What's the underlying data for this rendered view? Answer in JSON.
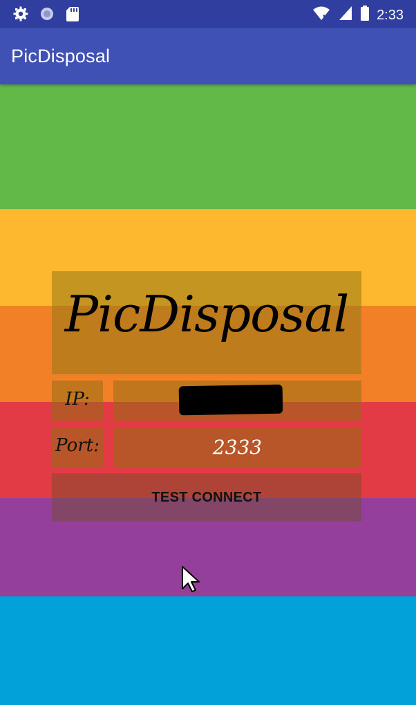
{
  "status_bar": {
    "time": "2:33",
    "icons": [
      "gear-icon",
      "sync-icon",
      "sd-card-icon",
      "wifi-icon",
      "signal-icon",
      "battery-icon"
    ]
  },
  "app_bar": {
    "title": "PicDisposal"
  },
  "stripes": [
    {
      "name": "green",
      "color": "#63b948"
    },
    {
      "name": "yellow",
      "color": "#fdb82f"
    },
    {
      "name": "orange",
      "color": "#f28026"
    },
    {
      "name": "red",
      "color": "#e23b46"
    },
    {
      "name": "purple",
      "color": "#953f9c"
    },
    {
      "name": "blue",
      "color": "#02a1d9"
    }
  ],
  "form": {
    "brand": "PicDisposal",
    "ip_label": "IP:",
    "ip_value": "",
    "port_label": "Port:",
    "port_value": "2333",
    "test_button": "TEST CONNECT"
  }
}
